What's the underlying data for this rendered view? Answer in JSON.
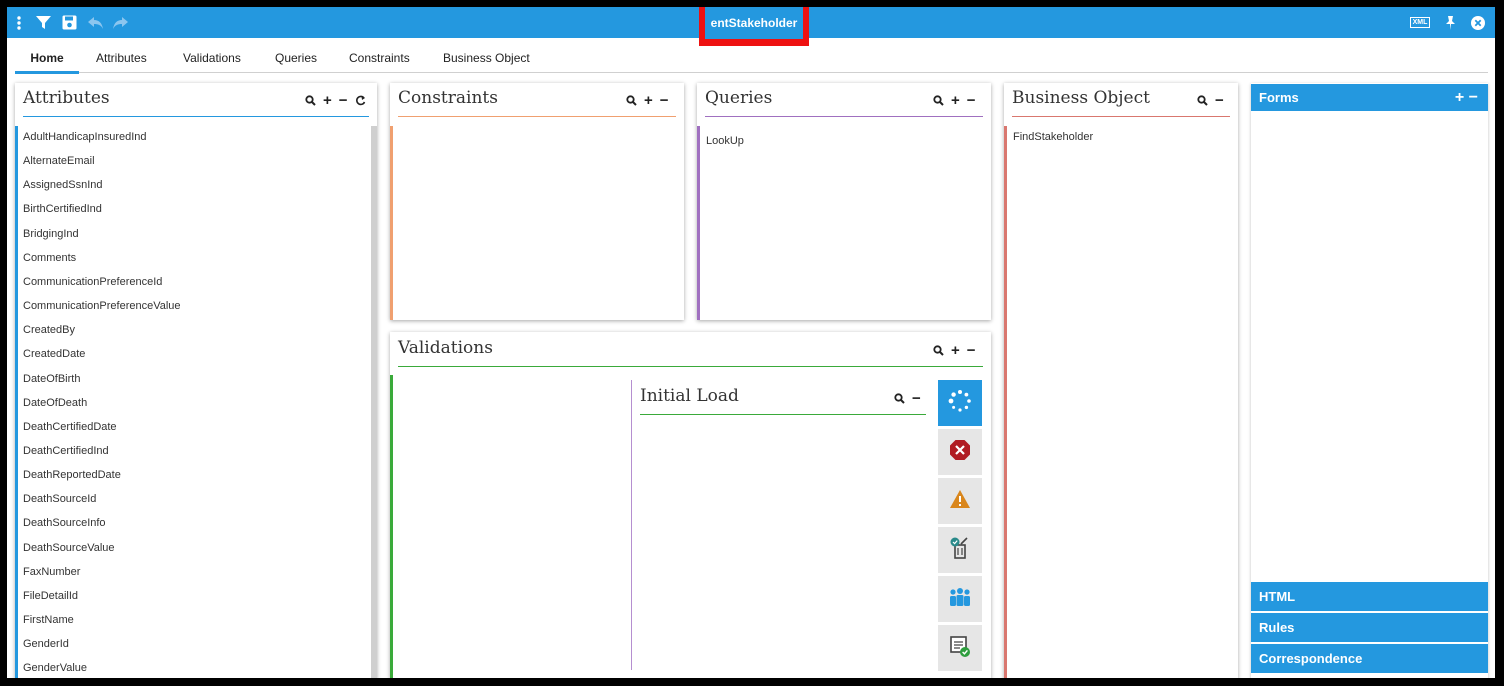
{
  "window": {
    "title": "entStakeholder",
    "xml_label": "XML"
  },
  "tabs": [
    {
      "label": "Home"
    },
    {
      "label": "Attributes"
    },
    {
      "label": "Validations"
    },
    {
      "label": "Queries"
    },
    {
      "label": "Constraints"
    },
    {
      "label": "Business Object"
    }
  ],
  "panels": {
    "attributes": {
      "title": "Attributes",
      "items": [
        "AdultHandicapInsuredInd",
        "AlternateEmail",
        "AssignedSsnInd",
        "BirthCertifiedInd",
        "BridgingInd",
        "Comments",
        "CommunicationPreferenceId",
        "CommunicationPreferenceValue",
        "CreatedBy",
        "CreatedDate",
        "DateOfBirth",
        "DateOfDeath",
        "DeathCertifiedDate",
        "DeathCertifiedInd",
        "DeathReportedDate",
        "DeathSourceId",
        "DeathSourceInfo",
        "DeathSourceValue",
        "FaxNumber",
        "FileDetailId",
        "FirstName",
        "GenderId",
        "GenderValue"
      ]
    },
    "constraints": {
      "title": "Constraints"
    },
    "queries": {
      "title": "Queries",
      "items": [
        "LookUp"
      ]
    },
    "business_object": {
      "title": "Business Object",
      "items": [
        "FindStakeholder"
      ]
    },
    "validations": {
      "title": "Validations"
    },
    "initial_load": {
      "title": "Initial Load"
    }
  },
  "icons": {
    "plus": "+",
    "minus": "−"
  },
  "right_panel": {
    "forms": "Forms",
    "html": "HTML",
    "rules": "Rules",
    "correspondence": "Correspondence"
  },
  "colors": {
    "accent": "#2498df",
    "attributes": "#2498df",
    "constraints": "#f0a070",
    "queries": "#a070c0",
    "business_object": "#d9776f",
    "validations": "#3aaa3a",
    "initial_load": "#b58fd0",
    "highlight": "#ee1111"
  }
}
